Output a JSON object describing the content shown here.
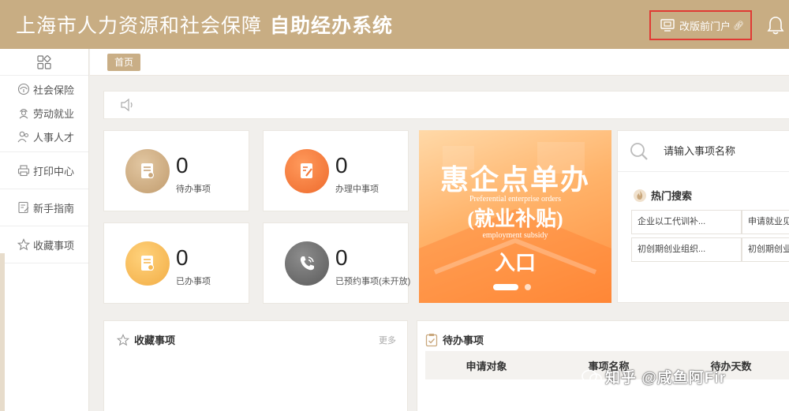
{
  "header": {
    "title_part1": "上海市人力资源和社会保障",
    "title_part2": "自助经办系统",
    "old_portal_label": "改版前门户",
    "colors": {
      "brand": "#c8ad83",
      "highlight_border": "#e03a34"
    }
  },
  "sidebar": {
    "items": [
      {
        "label": "社会保险",
        "icon": "umbrella-icon"
      },
      {
        "label": "劳动就业",
        "icon": "worker-icon"
      },
      {
        "label": "人事人才",
        "icon": "people-icon"
      },
      {
        "label": "打印中心",
        "icon": "printer-icon"
      },
      {
        "label": "新手指南",
        "icon": "guide-icon"
      },
      {
        "label": "收藏事项",
        "icon": "star-icon"
      }
    ]
  },
  "breadcrumb": {
    "tab": "首页"
  },
  "stats": [
    {
      "value": "0",
      "label": "待办事项",
      "color": "#c9a77c"
    },
    {
      "value": "0",
      "label": "办理中事项",
      "color": "#f27a3c"
    },
    {
      "value": "0",
      "label": "已办事项",
      "color": "#f6b955"
    },
    {
      "value": "0",
      "label": "已预约事项(未开放)",
      "color": "#6f6f6f"
    }
  ],
  "banner": {
    "title": "惠企点单办",
    "subtitle_en": "Preferential enterprise orders",
    "sub": "(就业补贴)",
    "sub_en": "employment subsidy",
    "entry": "入口"
  },
  "search": {
    "placeholder": "请输入事项名称",
    "hot_title": "热门搜索",
    "hot_items": [
      "企业以工代训补...",
      "申请就业见...",
      "初创期创业组织...",
      "初创期创业..."
    ]
  },
  "favorites": {
    "title": "收藏事项",
    "more": "更多"
  },
  "todo": {
    "title": "待办事项",
    "columns": [
      "申请对象",
      "事项名称",
      "待办天数"
    ]
  },
  "watermark": "知乎 @咸鱼阿Fir"
}
